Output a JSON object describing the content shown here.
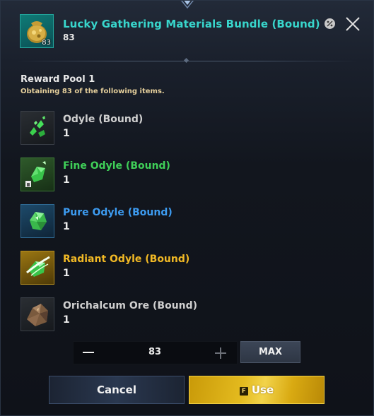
{
  "header": {
    "title": "Lucky Gathering Materials Bundle (Bound)",
    "owned_count": "83",
    "icon_count": "83"
  },
  "reward_pool": {
    "title": "Reward Pool 1",
    "subtitle": "Obtaining 83 of the following items."
  },
  "items": [
    {
      "name": "Odyle (Bound)",
      "qty": "1",
      "grade": "common",
      "icon": "odyle-icon"
    },
    {
      "name": "Fine Odyle (Bound)",
      "qty": "1",
      "grade": "uncommon",
      "icon": "fine-odyle-icon",
      "badge": "lock"
    },
    {
      "name": "Pure Odyle (Bound)",
      "qty": "1",
      "grade": "rare",
      "icon": "pure-odyle-icon"
    },
    {
      "name": "Radiant Odyle (Bound)",
      "qty": "1",
      "grade": "epic",
      "icon": "radiant-odyle-icon"
    },
    {
      "name": "Orichalcum Ore (Bound)",
      "qty": "1",
      "grade": "common",
      "icon": "orichalcum-ore-icon"
    }
  ],
  "quantity": {
    "value": "83",
    "max_label": "MAX"
  },
  "actions": {
    "cancel_label": "Cancel",
    "use_key": "F",
    "use_label": "Use"
  },
  "colors": {
    "title": "#38d6cc",
    "subtitle_note": "#e5cf9b",
    "common": "#cfcfcf",
    "uncommon": "#3fcf58",
    "rare": "#3d9bf0",
    "epic": "#f2b925",
    "use_button": "#e4bb1f"
  }
}
